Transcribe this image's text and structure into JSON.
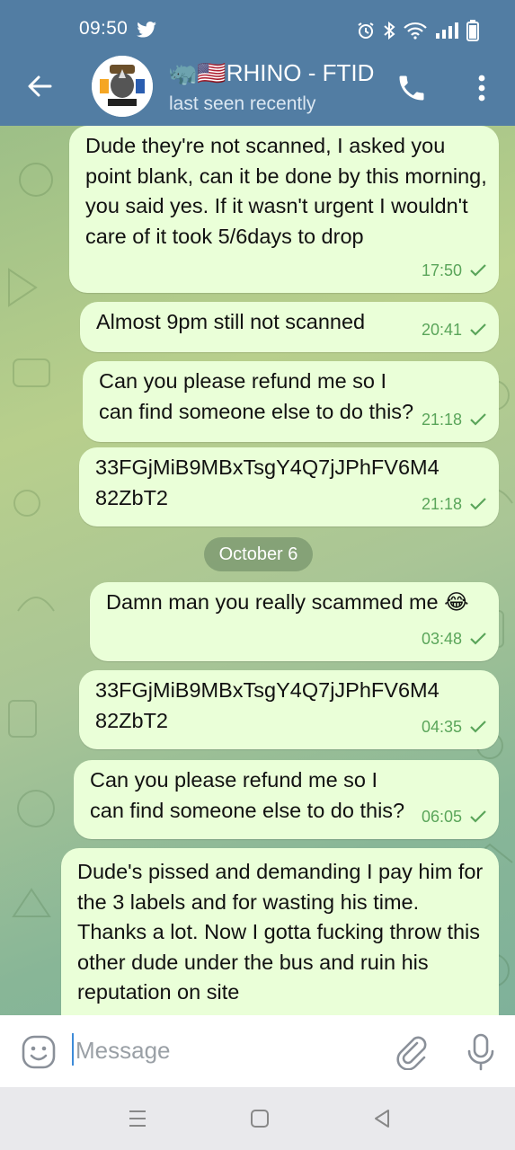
{
  "status_bar": {
    "time": "09:50"
  },
  "header": {
    "title": "🦏🇺🇸RHINO - FTID",
    "subtitle": "last seen recently"
  },
  "date_separator": "October 6",
  "messages": [
    {
      "text": "Dude they're not scanned, I asked you point blank, can it be done by this morning, you said yes. If it wasn't urgent I wouldn't care of it took 5/6days to drop",
      "time": "17:50"
    },
    {
      "text": "Almost 9pm still not scanned",
      "time": "20:41"
    },
    {
      "text": "Can you please refund me so I can find someone else to do this?",
      "time": "21:18"
    },
    {
      "text": "33FGjMiB9MBxTsgY4Q7jJPhFV6M4 82ZbT2",
      "time": "21:18"
    },
    {
      "text": "Damn man you really scammed me 😂",
      "time": "03:48"
    },
    {
      "text": "33FGjMiB9MBxTsgY4Q7jJPhFV6M4 82ZbT2",
      "time": "04:35"
    },
    {
      "text": "Can you please refund me so I can find someone else to do this?",
      "time": "06:05"
    },
    {
      "text": "Dude's pissed and demanding I pay him for the 3 labels and for wasting his time. Thanks a lot. Now I gotta fucking throw this other dude under the bus and ruin his reputation on site",
      "time": ""
    }
  ],
  "input": {
    "placeholder": "Message"
  },
  "colors": {
    "header": "#527da3",
    "bubble": "#eaffd8",
    "check": "#5aa55a"
  }
}
